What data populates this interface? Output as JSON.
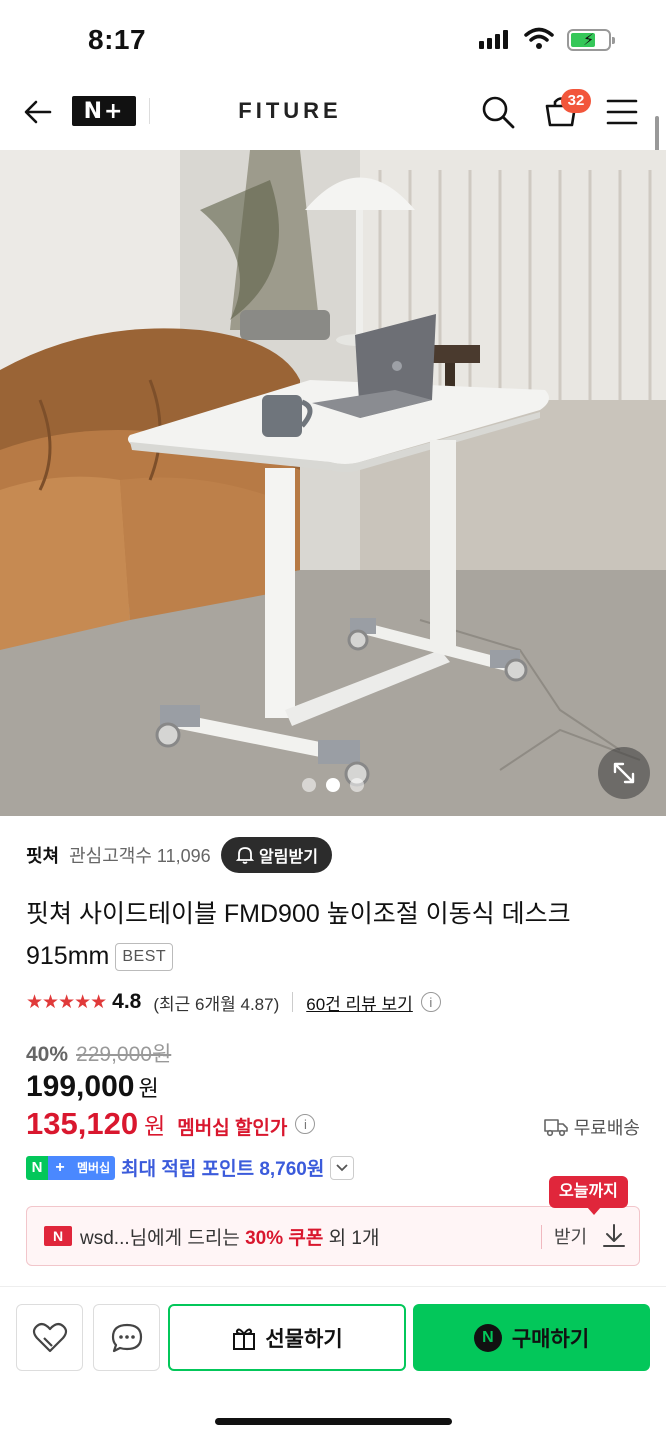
{
  "status": {
    "time": "8:17"
  },
  "nav": {
    "logo_text": "N+",
    "brand": "FITURE",
    "cart_count": "32"
  },
  "hero": {
    "slide_count": 3,
    "active_slide": 2
  },
  "seller": {
    "name": "핏쳐",
    "fans": "관심고객수 11,096",
    "alarm_label": "알림받기"
  },
  "product": {
    "title": "핏쳐 사이드테이블 FMD900 높이조절 이동식 데스크 915mm",
    "badge": "BEST"
  },
  "rating": {
    "stars": "★★★★★",
    "score": "4.8",
    "recent": "(최근 6개월 4.87)",
    "reviews_link": "60건 리뷰 보기"
  },
  "price": {
    "discount": "40%",
    "original": "229,000원",
    "sale": "199,000",
    "won": "원",
    "member_price": "135,120",
    "member_won": "원",
    "member_label": "멤버십 할인가",
    "shipping": "무료배송"
  },
  "points": {
    "n": "N",
    "plus": "+",
    "tag": "멤버십",
    "text": "최대 적립 포인트 8,760원"
  },
  "coupon": {
    "tooltip": "오늘까지",
    "icon_text": "N",
    "prefix": "wsd...님에게 드리는 ",
    "highlight": "30% 쿠폰",
    "suffix": " 외 1개",
    "action": "받기"
  },
  "bottom": {
    "gift_label": "선물하기",
    "buy_label": "구매하기",
    "buy_icon": "N"
  },
  "colors": {
    "naver_green": "#03c75a",
    "price_red": "#d9172e",
    "point_blue": "#3b5bdb"
  }
}
